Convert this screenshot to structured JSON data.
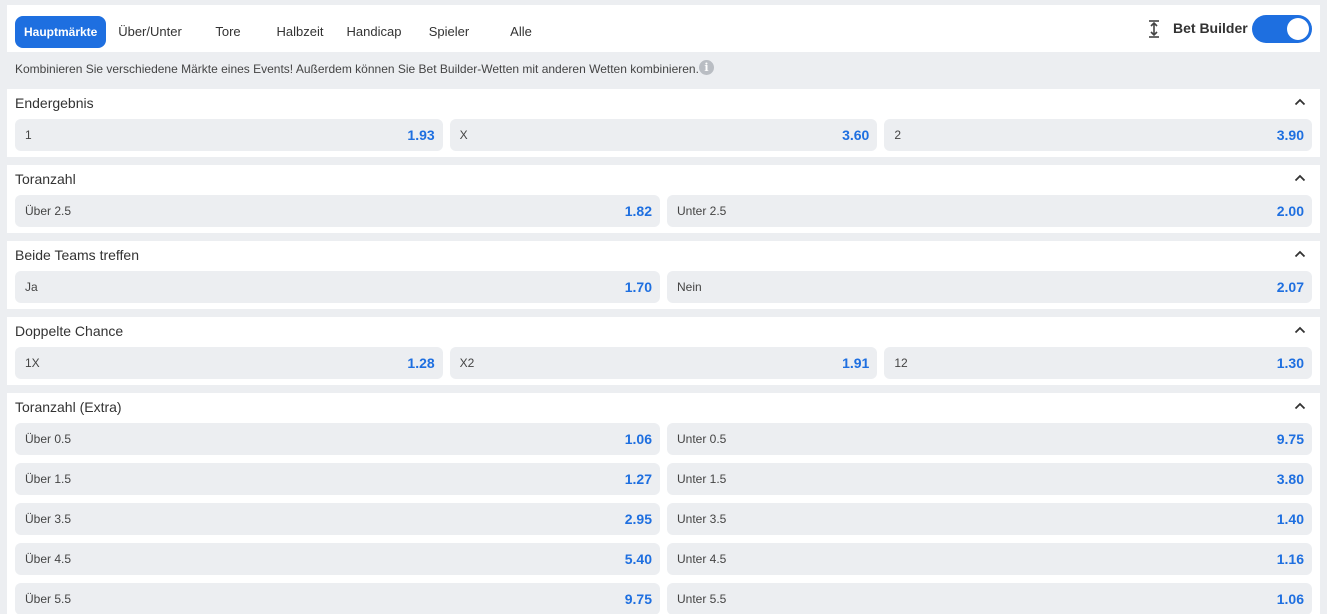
{
  "tabs": [
    {
      "label": "Hauptmärkte",
      "active": true
    },
    {
      "label": "Über/Unter"
    },
    {
      "label": "Tore"
    },
    {
      "label": "Halbzeit"
    },
    {
      "label": "Handicap"
    },
    {
      "label": "Spieler"
    },
    {
      "label": "Alle"
    }
  ],
  "bet_builder": {
    "label": "Bet Builder",
    "enabled": true,
    "icon": "expand-vertical-icon"
  },
  "info": {
    "text": "Kombinieren Sie verschiedene Märkte eines Events! Außerdem können Sie Bet Builder-Wetten mit anderen Wetten kombinieren.",
    "icon": "info-icon"
  },
  "colors": {
    "accent": "#1e6fe0",
    "background": "#eceef1",
    "card": "#ffffff",
    "odd_button": "#eceef1"
  },
  "markets": [
    {
      "title": "Endergebnis",
      "collapsed": false,
      "rows": [
        [
          {
            "label": "1",
            "price": "1.93"
          },
          {
            "label": "X",
            "price": "3.60"
          },
          {
            "label": "2",
            "price": "3.90"
          }
        ]
      ]
    },
    {
      "title": "Toranzahl",
      "collapsed": false,
      "rows": [
        [
          {
            "label": "Über 2.5",
            "price": "1.82"
          },
          {
            "label": "Unter 2.5",
            "price": "2.00"
          }
        ]
      ]
    },
    {
      "title": "Beide Teams treffen",
      "collapsed": false,
      "rows": [
        [
          {
            "label": "Ja",
            "price": "1.70"
          },
          {
            "label": "Nein",
            "price": "2.07"
          }
        ]
      ]
    },
    {
      "title": "Doppelte Chance",
      "collapsed": false,
      "rows": [
        [
          {
            "label": "1X",
            "price": "1.28"
          },
          {
            "label": "X2",
            "price": "1.91"
          },
          {
            "label": "12",
            "price": "1.30"
          }
        ]
      ]
    },
    {
      "title": "Toranzahl (Extra)",
      "collapsed": false,
      "rows": [
        [
          {
            "label": "Über 0.5",
            "price": "1.06"
          },
          {
            "label": "Unter 0.5",
            "price": "9.75"
          }
        ],
        [
          {
            "label": "Über 1.5",
            "price": "1.27"
          },
          {
            "label": "Unter 1.5",
            "price": "3.80"
          }
        ],
        [
          {
            "label": "Über 3.5",
            "price": "2.95"
          },
          {
            "label": "Unter 3.5",
            "price": "1.40"
          }
        ],
        [
          {
            "label": "Über 4.5",
            "price": "5.40"
          },
          {
            "label": "Unter 4.5",
            "price": "1.16"
          }
        ],
        [
          {
            "label": "Über 5.5",
            "price": "9.75"
          },
          {
            "label": "Unter 5.5",
            "price": "1.06"
          }
        ]
      ]
    }
  ]
}
